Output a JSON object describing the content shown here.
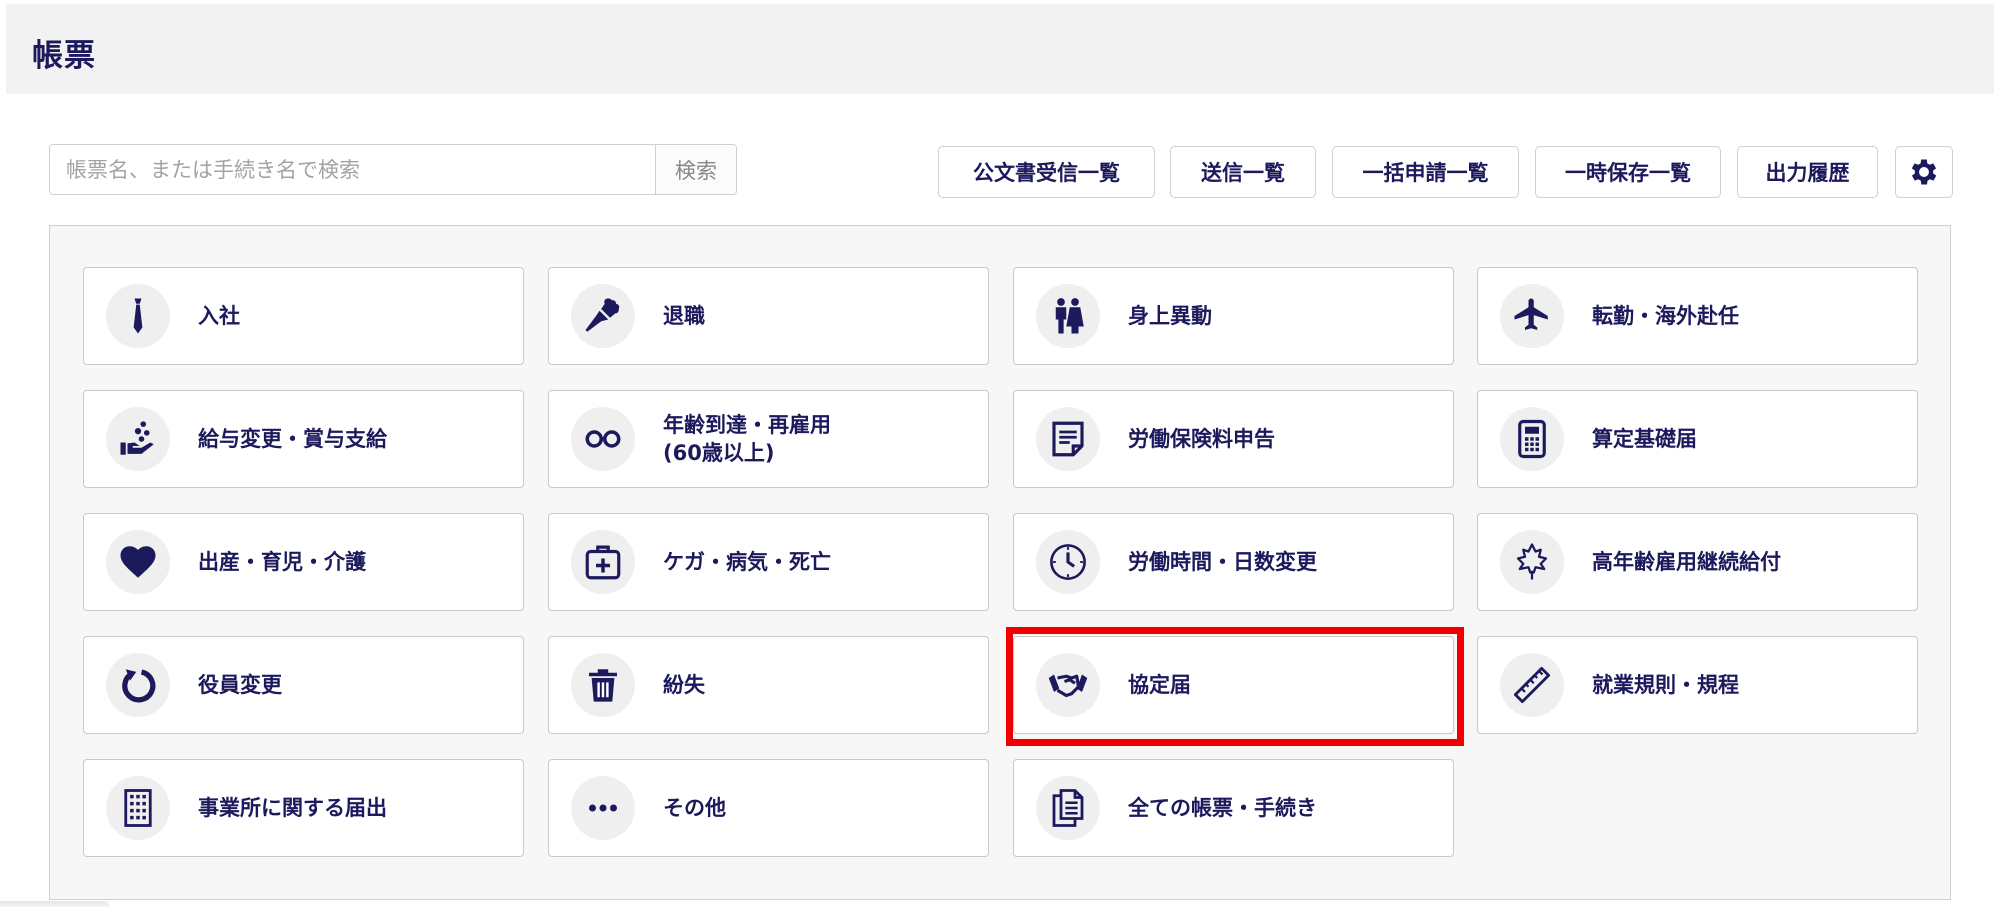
{
  "header": {
    "title": "帳票"
  },
  "search": {
    "placeholder": "帳票名、または手続き名で検索",
    "value": "",
    "button_label": "検索"
  },
  "toolbar": {
    "buttons": [
      {
        "label": "公文書受信一覧"
      },
      {
        "label": "送信一覧"
      },
      {
        "label": "一括申請一覧"
      },
      {
        "label": "一時保存一覧"
      },
      {
        "label": "出力履歴"
      }
    ],
    "settings_icon": "gear-icon"
  },
  "tiles": [
    {
      "label": "入社",
      "icon": "necktie-icon"
    },
    {
      "label": "退職",
      "icon": "bouquet-icon"
    },
    {
      "label": "身上異動",
      "icon": "couple-icon"
    },
    {
      "label": "転勤・海外赴任",
      "icon": "airplane-icon"
    },
    {
      "label": "給与変更・賞与支給",
      "icon": "hand-coins-icon"
    },
    {
      "label": "年齢到達・再雇用\n(60歳以上)",
      "icon": "glasses-icon"
    },
    {
      "label": "労働保険料申告",
      "icon": "document-icon"
    },
    {
      "label": "算定基礎届",
      "icon": "calculator-icon"
    },
    {
      "label": "出産・育児・介護",
      "icon": "heart-icon"
    },
    {
      "label": "ケガ・病気・死亡",
      "icon": "first-aid-kit-icon"
    },
    {
      "label": "労働時間・日数変更",
      "icon": "clock-icon"
    },
    {
      "label": "高年齢雇用継続給付",
      "icon": "maple-leaf-icon"
    },
    {
      "label": "役員変更",
      "icon": "refresh-icon"
    },
    {
      "label": "紛失",
      "icon": "trash-icon"
    },
    {
      "label": "協定届",
      "icon": "handshake-icon"
    },
    {
      "label": "就業規則・規程",
      "icon": "ruler-icon"
    },
    {
      "label": "事業所に関する届出",
      "icon": "building-icon"
    },
    {
      "label": "その他",
      "icon": "more-dots-icon"
    },
    {
      "label": "全ての帳票・手続き",
      "icon": "documents-icon"
    }
  ],
  "colors": {
    "accent": "#1c1a5c",
    "highlight": "#f00000",
    "header_bg": "#f2f2f2"
  }
}
